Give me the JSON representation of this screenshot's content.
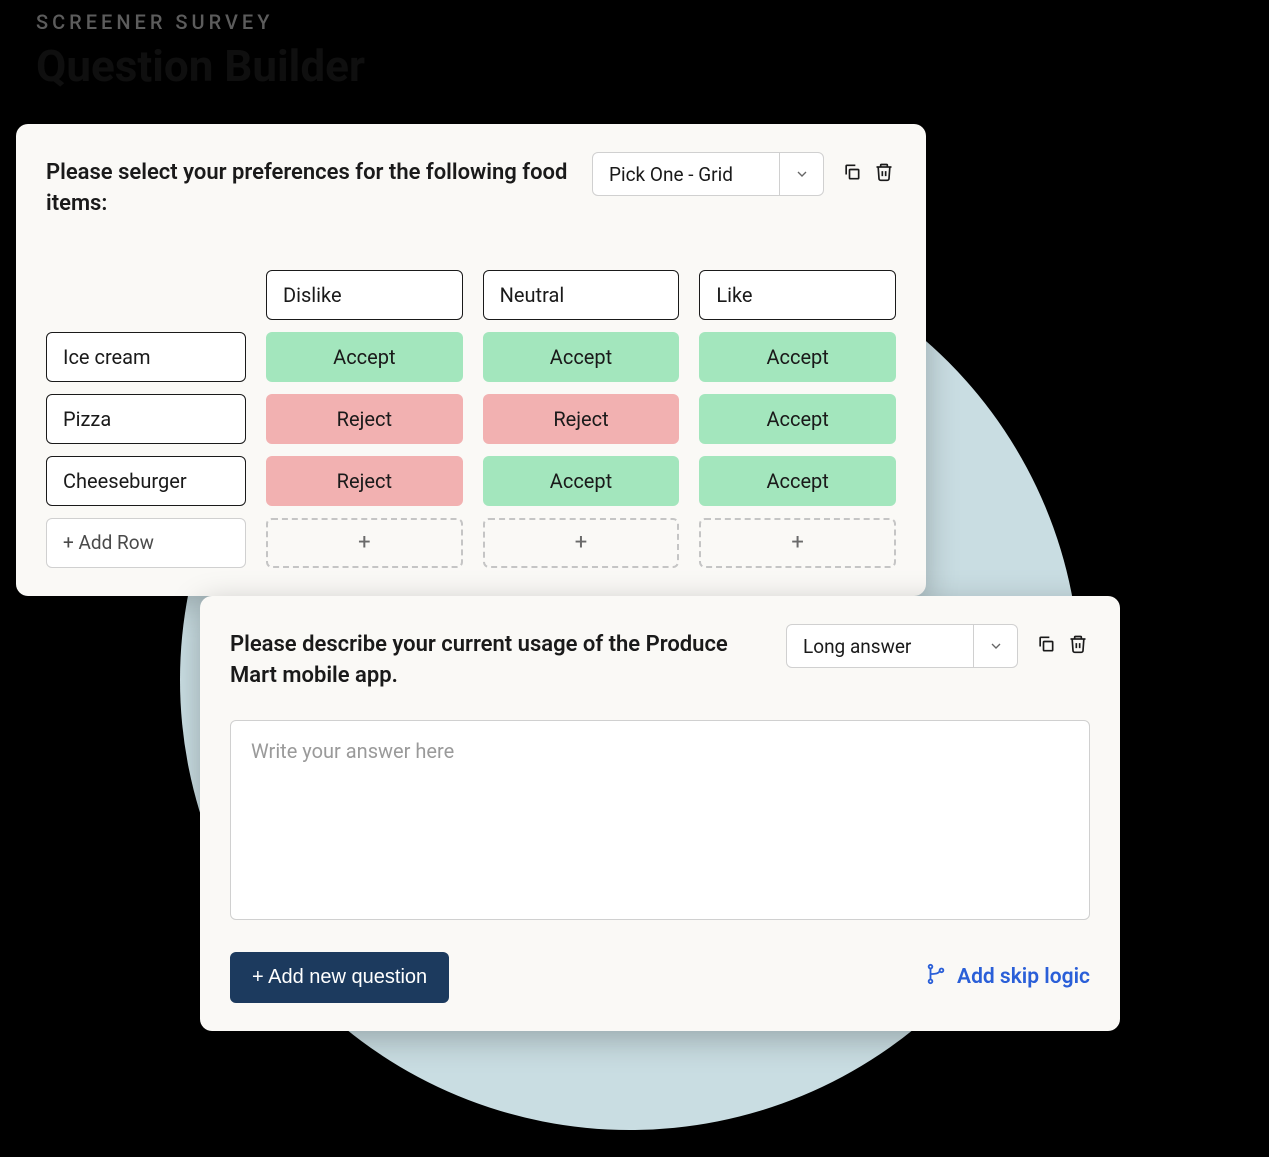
{
  "header": {
    "eyebrow": "SCREENER SURVEY",
    "title": "Question Builder"
  },
  "card1": {
    "question": "Please select your preferences for the following food items:",
    "type_selected": "Pick One - Grid",
    "columns": [
      "Dislike",
      "Neutral",
      "Like"
    ],
    "rows": [
      {
        "label": "Ice cream",
        "cells": [
          "Accept",
          "Accept",
          "Accept"
        ]
      },
      {
        "label": "Pizza",
        "cells": [
          "Reject",
          "Reject",
          "Accept"
        ]
      },
      {
        "label": "Cheeseburger",
        "cells": [
          "Reject",
          "Accept",
          "Accept"
        ]
      }
    ],
    "add_row_label": "+ Add Row",
    "add_cell_label": "+"
  },
  "card2": {
    "question": "Please describe your current usage of the Produce Mart mobile app.",
    "type_selected": "Long answer",
    "placeholder": "Write your answer here",
    "add_question_label": "+ Add new question",
    "skip_logic_label": "Add skip logic"
  },
  "colors": {
    "accept": "#a3e6bd",
    "reject": "#f2b1b1",
    "primary_btn": "#1c3a5e",
    "link": "#2a5fd8",
    "circle": "#c9dde2"
  }
}
